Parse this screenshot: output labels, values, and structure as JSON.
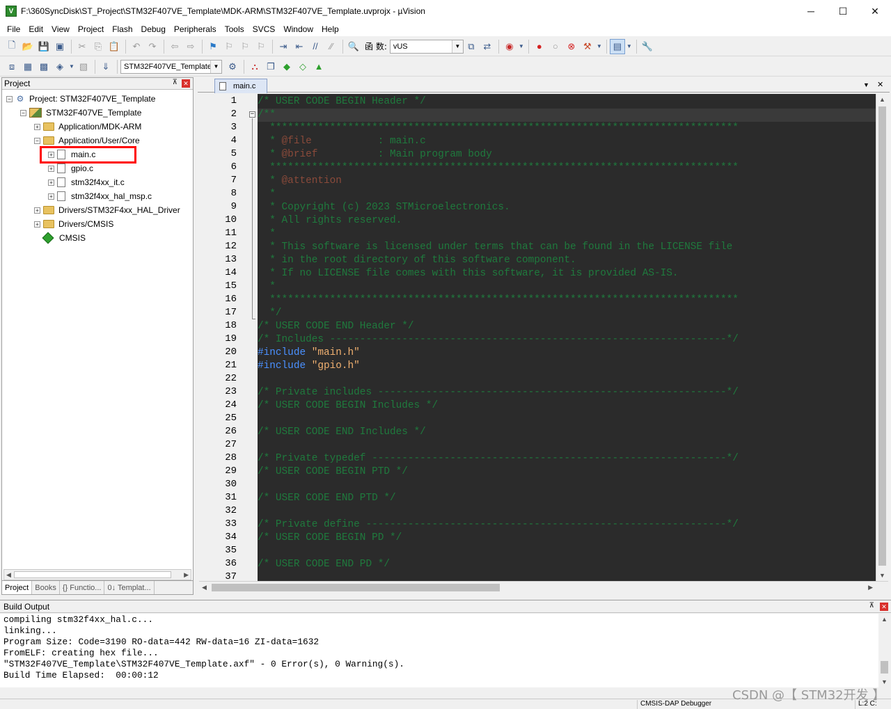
{
  "window": {
    "title": "F:\\360SyncDisk\\ST_Project\\STM32F407VE_Template\\MDK-ARM\\STM32F407VE_Template.uvprojx - µVision",
    "app_icon": "keil-logo-icon",
    "minimize": "─",
    "maximize": "☐",
    "close": "✕"
  },
  "menu": [
    "File",
    "Edit",
    "View",
    "Project",
    "Flash",
    "Debug",
    "Peripherals",
    "Tools",
    "SVCS",
    "Window",
    "Help"
  ],
  "toolbar1": {
    "func_label": "函 数:",
    "func_value": "vUS"
  },
  "toolbar2": {
    "target_value": "STM32F407VE_Template"
  },
  "project_panel": {
    "title": "Project",
    "pin": "⊼",
    "close": "✕",
    "tree": [
      {
        "label": "Project: STM32F407VE_Template",
        "exp": "⊟"
      },
      {
        "label": "STM32F407VE_Template",
        "exp": "⊟"
      },
      {
        "label": "Application/MDK-ARM",
        "exp": "+"
      },
      {
        "label": "Application/User/Core",
        "exp": "−"
      },
      {
        "label": "main.c",
        "exp": "+"
      },
      {
        "label": "gpio.c",
        "exp": "+"
      },
      {
        "label": "stm32f4xx_it.c",
        "exp": "+"
      },
      {
        "label": "stm32f4xx_hal_msp.c",
        "exp": "+"
      },
      {
        "label": "Drivers/STM32F4xx_HAL_Driver",
        "exp": "+"
      },
      {
        "label": "Drivers/CMSIS",
        "exp": "+"
      },
      {
        "label": "CMSIS",
        "exp": ""
      }
    ],
    "tabs": [
      "Project",
      "Books",
      "{} Functio...",
      "0↓ Templat..."
    ]
  },
  "editor": {
    "tab": "main.c",
    "tab_menu": "▼",
    "tab_close": "✕",
    "line_numbers": [
      "1",
      "2",
      "3",
      "4",
      "5",
      "6",
      "7",
      "8",
      "9",
      "10",
      "11",
      "12",
      "13",
      "14",
      "15",
      "16",
      "17",
      "18",
      "19",
      "20",
      "21",
      "22",
      "23",
      "24",
      "25",
      "26",
      "27",
      "28",
      "29",
      "30",
      "31",
      "32",
      "33",
      "34",
      "35",
      "36",
      "37"
    ],
    "fold_mark": "−",
    "code": {
      "l1": "/* USER CODE BEGIN Header */",
      "l2": "/**",
      "l3": "  ******************************************************************************",
      "l4a": "  * ",
      "l4b": "@file",
      "l4c": "           : main.c",
      "l5a": "  * ",
      "l5b": "@brief",
      "l5c": "          : Main program body",
      "l6": "  ******************************************************************************",
      "l7a": "  * ",
      "l7b": "@attention",
      "l8": "  *",
      "l9": "  * Copyright (c) 2023 STMicroelectronics.",
      "l10": "  * All rights reserved.",
      "l11": "  *",
      "l12": "  * This software is licensed under terms that can be found in the LICENSE file",
      "l13": "  * in the root directory of this software component.",
      "l14": "  * If no LICENSE file comes with this software, it is provided AS-IS.",
      "l15": "  *",
      "l16": "  ******************************************************************************",
      "l17": "  */",
      "l18": "/* USER CODE END Header */",
      "l19": "/* Includes ------------------------------------------------------------------*/",
      "l20a": "#include ",
      "l20b": "\"main.h\"",
      "l21a": "#include ",
      "l21b": "\"gpio.h\"",
      "l22": "",
      "l23": "/* Private includes ----------------------------------------------------------*/",
      "l24": "/* USER CODE BEGIN Includes */",
      "l25": "",
      "l26": "/* USER CODE END Includes */",
      "l27": "",
      "l28": "/* Private typedef -----------------------------------------------------------*/",
      "l29": "/* USER CODE BEGIN PTD */",
      "l30": "",
      "l31": "/* USER CODE END PTD */",
      "l32": "",
      "l33": "/* Private define ------------------------------------------------------------*/",
      "l34": "/* USER CODE BEGIN PD */",
      "l35": "",
      "l36": "/* USER CODE END PD */"
    }
  },
  "build_output": {
    "title": "Build Output",
    "lines": [
      "compiling stm32f4xx_hal.c...",
      "linking...",
      "Program Size: Code=3190 RO-data=442 RW-data=16 ZI-data=1632",
      "FromELF: creating hex file...",
      "\"STM32F407VE_Template\\STM32F407VE_Template.axf\" - 0 Error(s), 0 Warning(s).",
      "Build Time Elapsed:  00:00:12"
    ]
  },
  "statusbar": {
    "debugger": "CMSIS-DAP Debugger",
    "position": "L:2 C:"
  },
  "watermark": "CSDN @【 STM32开发 】"
}
